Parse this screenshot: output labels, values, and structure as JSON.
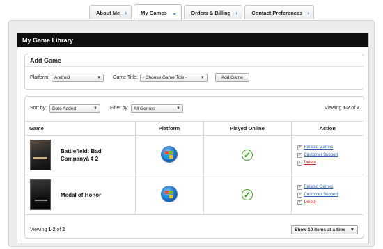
{
  "tabs": [
    {
      "label": "About Me",
      "active": false
    },
    {
      "label": "My Games",
      "active": true
    },
    {
      "label": "Orders & Billing",
      "active": false
    },
    {
      "label": "Contact Preferences",
      "active": false
    }
  ],
  "library": {
    "title": "My Game Library"
  },
  "add_game": {
    "title": "Add Game",
    "platform_label": "Platform:",
    "platform_value": "Android",
    "game_title_label": "Game Title:",
    "game_title_value": "- Choose Game Title -",
    "add_button": "Add Game"
  },
  "games": {
    "sort_label": "Sort by:",
    "sort_value": "Date Added",
    "filter_label": "Filter by:",
    "filter_value": "All Genres",
    "viewing_prefix": "Viewing",
    "viewing_range": "1-2",
    "viewing_of": "of",
    "viewing_total": "2",
    "columns": [
      "Game",
      "Platform",
      "Played Online",
      "Action"
    ],
    "rows": [
      {
        "name": "Battlefield: Bad Companyâ ¢ 2",
        "platform": "windows-icon",
        "played_online": "check-icon",
        "actions": [
          "Related Games",
          "Customer Support",
          "Delete"
        ]
      },
      {
        "name": "Medal of Honor",
        "platform": "windows-icon",
        "played_online": "check-icon",
        "actions": [
          "Related Games",
          "Customer Support",
          "Delete"
        ]
      }
    ],
    "footer_viewing_prefix": "Viewing",
    "footer_viewing_range": "1-2",
    "footer_viewing_of": "of",
    "footer_viewing_total": "2",
    "page_size_value": "Show 10 items at a time"
  },
  "colors": {
    "header_bg": "#0f0f0f",
    "link": "#2a5fb8",
    "delete": "#cc2222",
    "tab_chevron": "#2a7fd6"
  }
}
